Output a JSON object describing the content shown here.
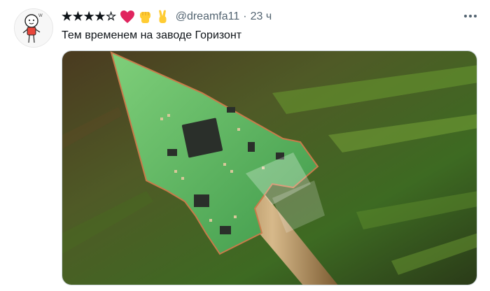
{
  "tweet": {
    "display_name": "★★★★☆",
    "handle": "@dreamfa11",
    "separator": "·",
    "time": "23 ч",
    "text": "Тем временем на заводе Горизонт",
    "name_emojis": [
      "red-heart",
      "raised-fist",
      "victory-hand"
    ],
    "colors": {
      "heart": "#e0245e",
      "fist": "#ffcc33",
      "secondary_text": "#536471",
      "primary_text": "#0f1419"
    }
  }
}
